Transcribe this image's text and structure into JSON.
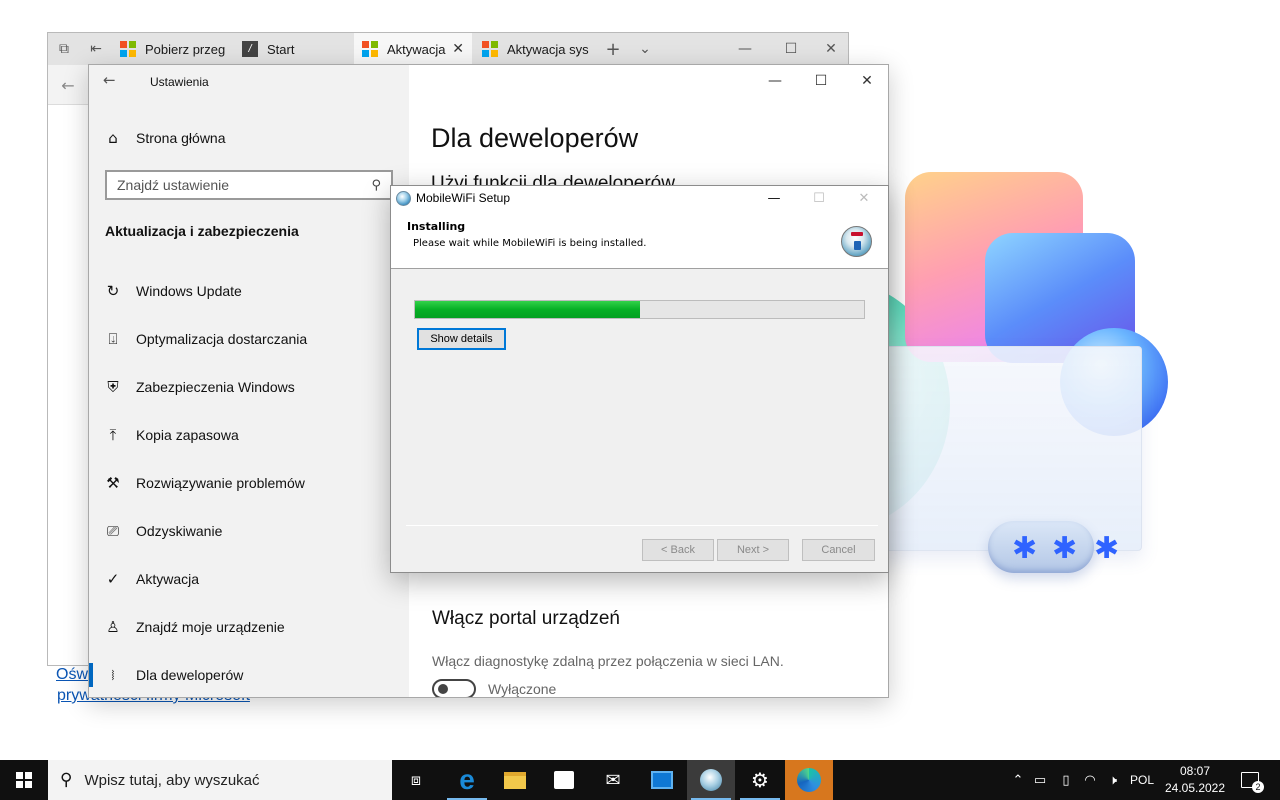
{
  "browser": {
    "tabs": [
      {
        "label": "Pobierz przeg"
      },
      {
        "label": "Start"
      },
      {
        "label": "Aktywacja"
      },
      {
        "label": "Aktywacja sys"
      }
    ],
    "link_line1": "Ośw",
    "link_line2": "prywatności firmy Microsoft"
  },
  "settings": {
    "window_title": "Ustawienia",
    "home_label": "Strona główna",
    "search_placeholder": "Znajdź ustawienie",
    "section_title": "Aktualizacja i zabezpieczenia",
    "nav": [
      {
        "label": "Windows Update",
        "icon": "refresh-icon"
      },
      {
        "label": "Optymalizacja dostarczania",
        "icon": "delivery-icon"
      },
      {
        "label": "Zabezpieczenia Windows",
        "icon": "shield-icon"
      },
      {
        "label": "Kopia zapasowa",
        "icon": "backup-icon"
      },
      {
        "label": "Rozwiązywanie problemów",
        "icon": "wrench-icon"
      },
      {
        "label": "Odzyskiwanie",
        "icon": "recovery-icon"
      },
      {
        "label": "Aktywacja",
        "icon": "check-circle-icon"
      },
      {
        "label": "Znajdź moje urządzenie",
        "icon": "person-location-icon"
      },
      {
        "label": "Dla deweloperów",
        "icon": "developer-icon",
        "selected": true
      }
    ],
    "page_title": "Dla deweloperów",
    "subheading": "Użyj funkcji dla deweloperów",
    "portal_heading": "Włącz portal urządzeń",
    "portal_desc": "Włącz diagnostykę zdalną przez połączenia w sieci LAN.",
    "toggle_state": "Wyłączone",
    "accent_color": "#0067c0"
  },
  "setup": {
    "title": "MobileWiFi Setup",
    "header_title": "Installing",
    "header_subtitle": "Please wait while MobileWiFi is being installed.",
    "progress_percent": 50,
    "show_details": "Show details",
    "back_label": "< Back",
    "next_label": "Next >",
    "cancel_label": "Cancel",
    "progress_color": "#06b025"
  },
  "taskbar": {
    "search_placeholder": "Wpisz tutaj, aby wyszukać",
    "language": "POL",
    "time": "08:07",
    "date": "24.05.2022",
    "notification_count": "2"
  }
}
